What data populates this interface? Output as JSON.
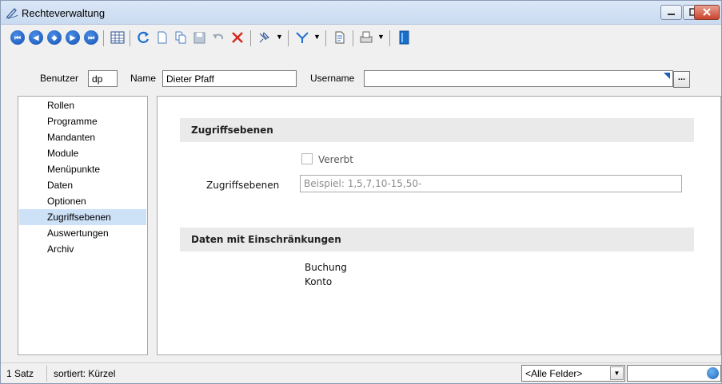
{
  "window": {
    "title": "Rechteverwaltung",
    "accent": "#1552b0"
  },
  "toolbar": {
    "nav_buttons": [
      "first-record",
      "previous-record",
      "center-record",
      "next-record",
      "last-record"
    ],
    "icons": [
      "table-icon",
      "refresh-icon",
      "new-icon",
      "copy-icon",
      "save-icon",
      "undo-icon",
      "delete-icon",
      "pin-icon",
      "filter-icon",
      "document-icon",
      "print-icon",
      "book-icon"
    ]
  },
  "header": {
    "benutzer_label": "Benutzer",
    "benutzer_value": "dp",
    "name_label": "Name",
    "name_value": "Dieter Pfaff",
    "username_label": "Username",
    "username_value": "",
    "dots_label": "..."
  },
  "sidebar": {
    "items": [
      {
        "label": "Rollen"
      },
      {
        "label": "Programme"
      },
      {
        "label": "Mandanten"
      },
      {
        "label": "Module"
      },
      {
        "label": "Menüpunkte"
      },
      {
        "label": "Daten"
      },
      {
        "label": "Optionen"
      },
      {
        "label": "Zugriffsebenen",
        "selected": true
      },
      {
        "label": "Auswertungen"
      },
      {
        "label": "Archiv"
      }
    ]
  },
  "main": {
    "section1_title": "Zugriffsebenen",
    "vererbt_label": "Vererbt",
    "vererbt_checked": false,
    "zugriffsebenen_label": "Zugriffsebenen",
    "zugriffsebenen_value": "",
    "zugriffsebenen_placeholder": "Beispiel: 1,5,7,10-15,50-",
    "section2_title": "Daten mit Einschränkungen",
    "data_items": [
      "Buchung",
      "Konto"
    ]
  },
  "status": {
    "count": "1 Satz",
    "sort": "sortiert: Kürzel",
    "field_filter": "<Alle Felder>",
    "search_value": ""
  }
}
